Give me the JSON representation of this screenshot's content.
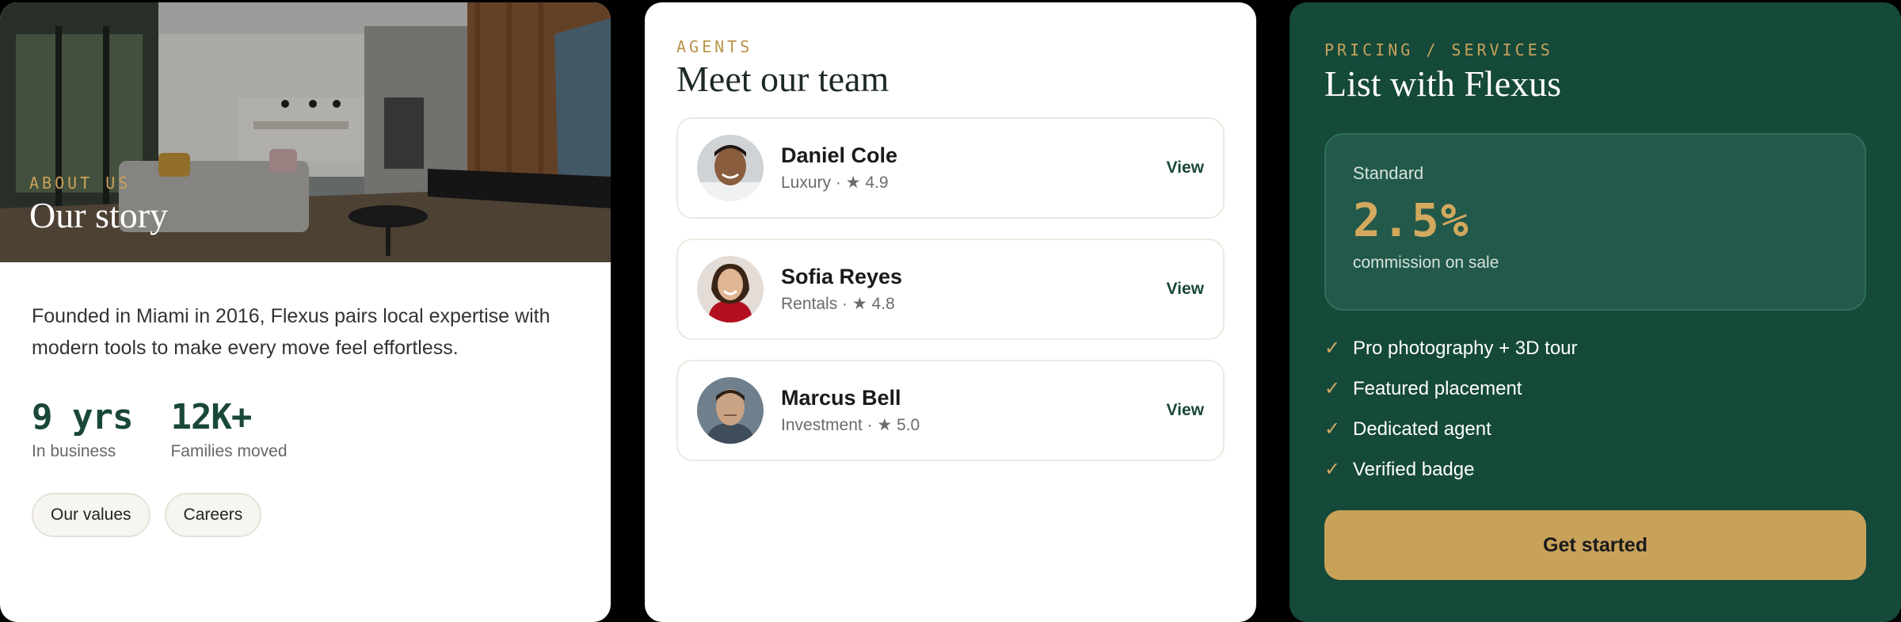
{
  "about": {
    "eyebrow": "ABOUT US",
    "title": "Our story",
    "description": "Founded in Miami in 2016, Flexus pairs local expertise with modern tools to make every move feel effortless.",
    "stats": [
      {
        "value": "9 yrs",
        "label": "In business"
      },
      {
        "value": "12K+",
        "label": "Families moved"
      }
    ],
    "chips": [
      "Our values",
      "Careers"
    ]
  },
  "team": {
    "eyebrow": "AGENTS",
    "title": "Meet our team",
    "agents": [
      {
        "name": "Daniel Cole",
        "meta": "Luxury · ★ 4.9",
        "action": "View"
      },
      {
        "name": "Sofia Reyes",
        "meta": "Rentals · ★ 4.8",
        "action": "View"
      },
      {
        "name": "Marcus Bell",
        "meta": "Investment · ★ 5.0",
        "action": "View"
      }
    ]
  },
  "pricing": {
    "eyebrow": "PRICING / SERVICES",
    "title": "List with Flexus",
    "plan": {
      "name": "Standard",
      "rate": "2.5%",
      "note": "commission on sale"
    },
    "features": [
      "Pro photography + 3D tour",
      "Featured placement",
      "Dedicated agent",
      "Verified badge"
    ],
    "cta": "Get started"
  },
  "colors": {
    "brand_green": "#15493a",
    "gold": "#c9a25a"
  }
}
